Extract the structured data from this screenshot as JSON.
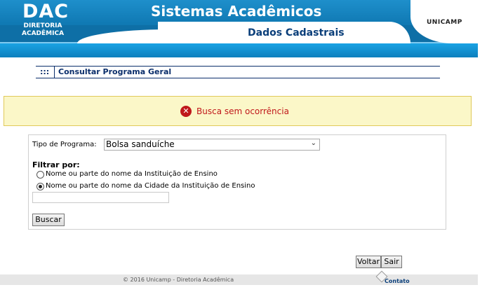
{
  "header": {
    "logo_big": "DAC",
    "logo_line1": "DIRETORIA",
    "logo_line2": "ACADÊMICA",
    "title": "Sistemas Acadêmicos",
    "subtitle": "Dados Cadastrais",
    "university": "UNICAMP"
  },
  "section": {
    "dots": ":::",
    "label": "Consultar Programa Geral"
  },
  "message": {
    "icon": "error-icon",
    "text": "Busca sem ocorrência",
    "color": "#c0181b"
  },
  "form": {
    "tipo_label": "Tipo de Programa:",
    "tipo_value": "Bolsa sanduíche",
    "filtrar_label": "Filtrar por:",
    "options": [
      {
        "label": "Nome ou parte do nome da Instituição de Ensino",
        "checked": false
      },
      {
        "label": "Nome ou parte do nome da Cidade da Instituição de Ensino",
        "checked": true
      }
    ],
    "filtro_value": "",
    "buscar_label": "Buscar"
  },
  "actions": {
    "voltar_label": "Voltar",
    "sair_label": "Sair"
  },
  "footer": {
    "copyright": "© 2016 Unicamp - Diretoria Acadêmica",
    "contato_label": "Contato"
  }
}
